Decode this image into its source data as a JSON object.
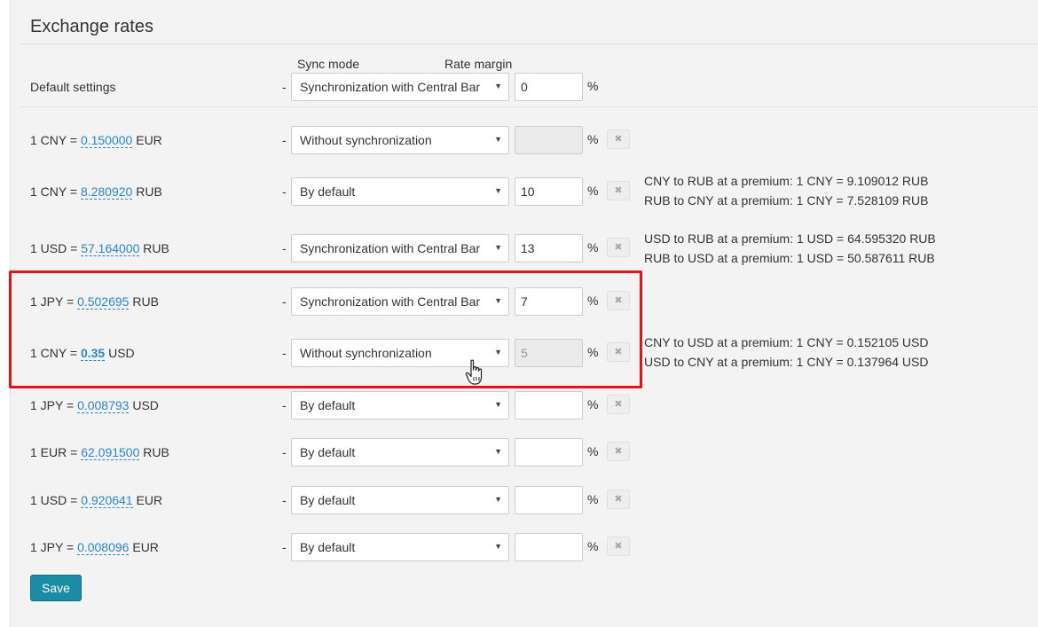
{
  "page": {
    "title": "Exchange rates"
  },
  "columns": {
    "sync_mode": "Sync mode",
    "rate_margin": "Rate margin"
  },
  "default_settings": {
    "label": "Default settings",
    "sync": "Synchronization with Central Bar",
    "margin": "0",
    "percent": "%"
  },
  "rows": [
    {
      "prefix": "1 CNY = ",
      "rate": "0.150000",
      "currency": " EUR",
      "sync": "Without synchronization",
      "margin": "",
      "percent": "%",
      "disabled": true
    },
    {
      "prefix": "1 CNY = ",
      "rate": "8.280920",
      "currency": " RUB",
      "sync": "By default",
      "margin": "10",
      "percent": "%"
    },
    {
      "prefix": "1 USD = ",
      "rate": "57.164000",
      "currency": " RUB",
      "sync": "Synchronization with Central Bar",
      "margin": "13",
      "percent": "%"
    },
    {
      "prefix": "1 JPY = ",
      "rate": "0.502695",
      "currency": " RUB",
      "sync": "Synchronization with Central Bar",
      "margin": "7",
      "percent": "%"
    },
    {
      "prefix": "1 CNY = ",
      "rate": "0.35",
      "currency": " USD",
      "sync": "Without synchronization",
      "margin": "5",
      "percent": "%",
      "disabled": true
    },
    {
      "prefix": "1 JPY = ",
      "rate": "0.008793",
      "currency": " USD",
      "sync": "By default",
      "margin": "",
      "percent": "%"
    },
    {
      "prefix": "1 EUR = ",
      "rate": "62.091500",
      "currency": " RUB",
      "sync": "By default",
      "margin": "",
      "percent": "%"
    },
    {
      "prefix": "1 USD = ",
      "rate": "0.920641",
      "currency": " EUR",
      "sync": "By default",
      "margin": "",
      "percent": "%"
    },
    {
      "prefix": "1 JPY = ",
      "rate": "0.008096",
      "currency": " EUR",
      "sync": "By default",
      "margin": "",
      "percent": "%"
    }
  ],
  "notes": {
    "cny_rub_1": "CNY to RUB at a premium: 1 CNY = 9.109012 RUB",
    "cny_rub_2": "RUB to CNY at a premium: 1 CNY = 7.528109 RUB",
    "usd_rub_1": "USD to RUB at a premium: 1 USD = 64.595320 RUB",
    "usd_rub_2": "RUB to USD at a premium: 1 USD = 50.587611 RUB",
    "cny_usd_1": "CNY to USD at a premium: 1 CNY = 0.152105 USD",
    "cny_usd_2": "USD to CNY at a premium: 1 CNY = 0.137964 USD"
  },
  "dash": "-",
  "remove_glyph": "✖",
  "dropdown_glyph": "▼",
  "save_label": "Save",
  "colors": {
    "accent": "#1a8ca6",
    "link": "#2a85d0",
    "highlight": "#e8101a"
  },
  "icons": {
    "remove": "close-icon",
    "dropdown": "chevron-down-icon",
    "cursor": "hand-pointer-icon"
  }
}
